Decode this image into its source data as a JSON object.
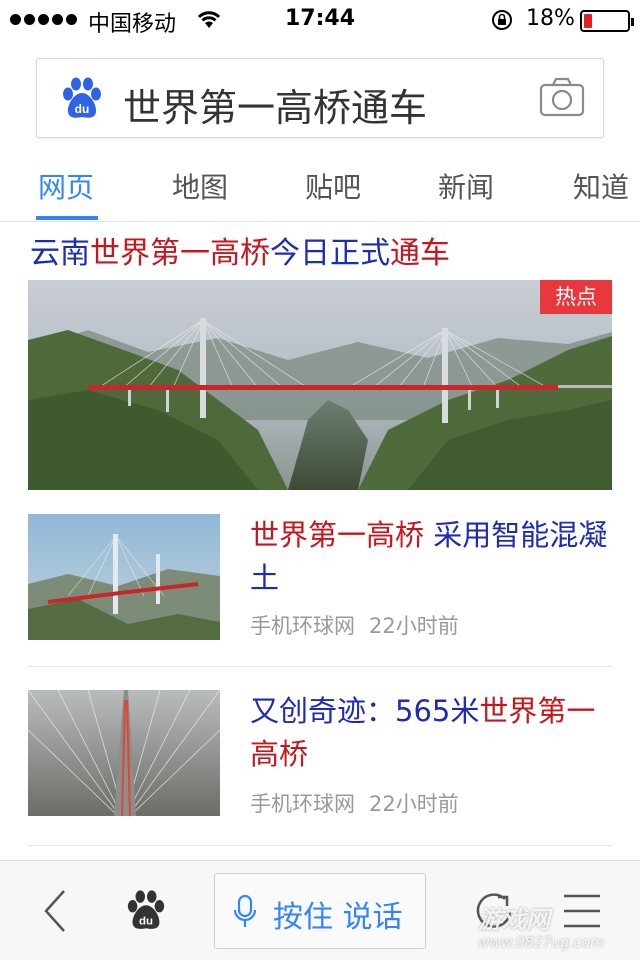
{
  "status_bar": {
    "carrier": "中国移动",
    "time": "17:44",
    "battery_percent": "18%",
    "battery_level": 0.18,
    "battery_color": "#e31e24"
  },
  "search": {
    "query": "世界第一高桥通车",
    "logo_text": "du"
  },
  "tabs": [
    {
      "label": "网页",
      "active": true
    },
    {
      "label": "地图",
      "active": false
    },
    {
      "label": "贴吧",
      "active": false
    },
    {
      "label": "新闻",
      "active": false
    },
    {
      "label": "知道",
      "active": false
    }
  ],
  "headline": {
    "part1": "云南",
    "part2": "世界第一高桥",
    "part3": "今日正式",
    "part4": "通车"
  },
  "hero": {
    "badge": "热点"
  },
  "news": [
    {
      "title_highlight": "世界第一高桥",
      "title_rest": " 采用智能混凝土",
      "source": "手机环球网",
      "time": "22小时前"
    },
    {
      "title_rest": "又创奇迹：565米",
      "title_highlight": "世界第一高桥",
      "source": "手机环球网",
      "time": "22小时前"
    }
  ],
  "toolbar": {
    "voice_label": "按住 说话",
    "baidu_text": "du"
  },
  "watermark": {
    "text": "游戏网",
    "url": "www.0827ug.com"
  },
  "colors": {
    "accent": "#3385ff",
    "link": "#1d2cb3",
    "highlight": "#c7161d",
    "badge": "#e8383d"
  }
}
